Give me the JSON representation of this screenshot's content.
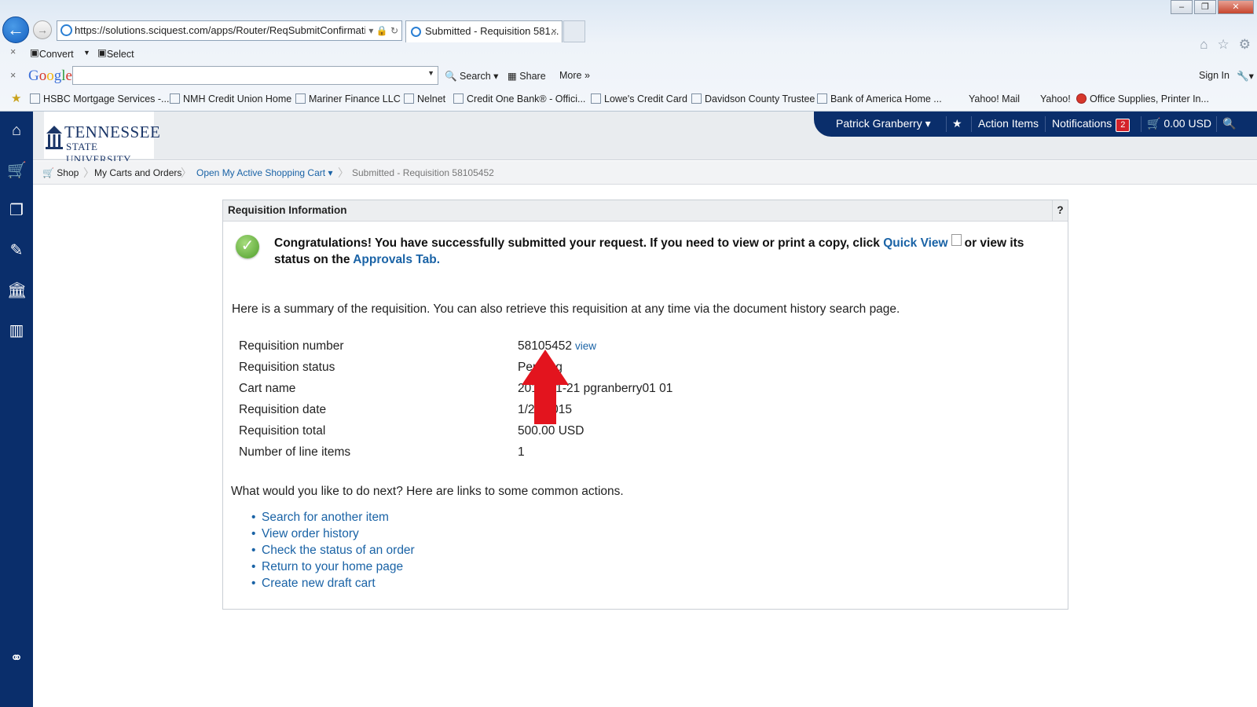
{
  "browser": {
    "url": "https://solutions.sciquest.com/apps/Router/ReqSubmitConfirmatio",
    "tab_title": "Submitted - Requisition 581...",
    "tab_close": "×",
    "back_icon": "back-arrow-icon",
    "forward_icon": "forward-arrow-icon",
    "command_bar": {
      "convert": "Convert",
      "select": "Select"
    },
    "google_toolbar": {
      "logo": "Google",
      "search": "Search",
      "share": "Share",
      "more": "More",
      "sign_in": "Sign In"
    },
    "favorites": [
      "HSBC Mortgage Services -...",
      "NMH Credit Union Home",
      "Mariner Finance LLC",
      "Nelnet",
      "Credit One Bank® - Offici...",
      "Lowe's Credit Card",
      "Davidson County Trustee",
      "Bank of America  Home ...",
      "Yahoo! Mail",
      "Yahoo!",
      "Office Supplies, Printer In..."
    ]
  },
  "header": {
    "logo_line1": "TENNESSEE",
    "logo_line2": "STATE UNIVERSITY",
    "user_name": "Patrick Granberry",
    "action_items": "Action Items",
    "notifications": "Notifications",
    "notifications_count": "2",
    "cart_total": "0.00 USD"
  },
  "breadcrumb": {
    "shop": "Shop",
    "carts_orders": "My Carts and Orders",
    "active_cart": "Open My Active Shopping Cart",
    "current": "Submitted - Requisition 58105452"
  },
  "panel": {
    "title": "Requisition Information",
    "help": "?",
    "congrats_prefix": "Congratulations! You have successfully submitted your request. If you need to view or print a copy, click",
    "quick_view": "Quick View",
    "congrats_mid": "or view its status on the",
    "approvals_tab": "Approvals Tab.",
    "summary": "Here is a summary of the requisition. You can also retrieve this requisition at any time via the document history search page.",
    "rows": [
      {
        "label": "Requisition number",
        "value": "58105452"
      },
      {
        "label": "Requisition status",
        "value": "Pending"
      },
      {
        "label": "Cart name",
        "value": "2015-01-21 pgranberry01 01"
      },
      {
        "label": "Requisition date",
        "value": "1/21/2015"
      },
      {
        "label": "Requisition total",
        "value": "500.00 USD"
      },
      {
        "label": "Number of line items",
        "value": "1"
      }
    ],
    "view_link": "view",
    "next_prompt": "What would you like to do next? Here are links to some common actions.",
    "actions": [
      "Search for another item",
      "View order history",
      "Check the status of an order",
      "Return to your home page",
      "Create new draft cart"
    ]
  },
  "colors": {
    "sidebar": "#0a2e6b",
    "link": "#1a63a6",
    "annotation_arrow": "#e3141e",
    "badge": "#d3232b"
  }
}
